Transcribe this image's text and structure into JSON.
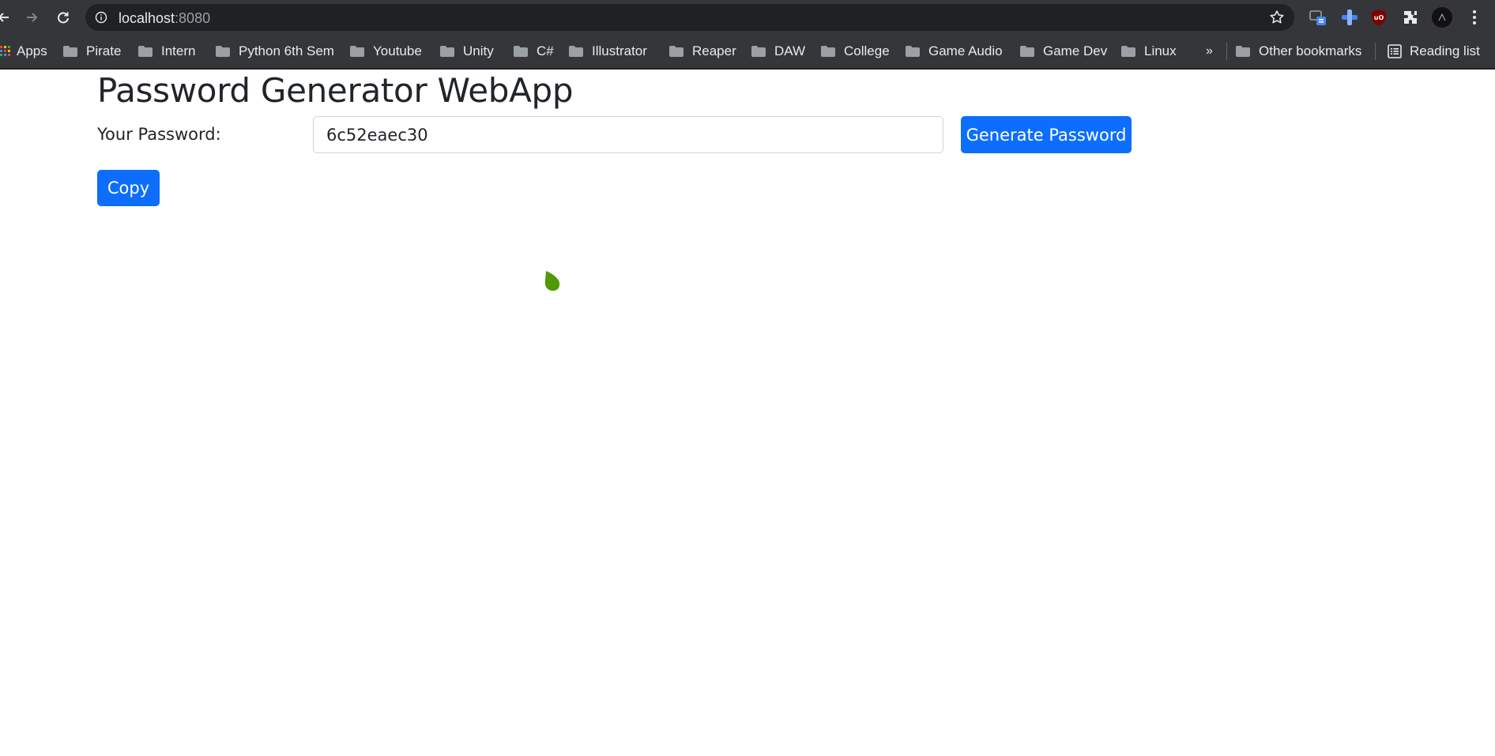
{
  "browser": {
    "url_host": "localhost",
    "url_port": ":8080",
    "icons": [
      "back-icon",
      "forward-icon",
      "reload-icon",
      "info-icon",
      "star-icon",
      "extensions-icon",
      "menu-icon"
    ]
  },
  "bookmarks": {
    "apps_label": "Apps",
    "items": [
      "Pirate",
      "Intern",
      "Python 6th Sem",
      "Youtube",
      "Unity",
      "C#",
      "Illustrator",
      "Reaper",
      "DAW",
      "College",
      "Game Audio",
      "Game Dev",
      "Linux"
    ],
    "overflow_label": "»",
    "other_label": "Other bookmarks",
    "reading_list_label": "Reading list"
  },
  "page": {
    "title": "Password Generator WebApp",
    "password_label": "Your Password:",
    "password_value": "6c52eaec30",
    "generate_button_label": "Generate Password",
    "copy_button_label": "Copy"
  },
  "colors": {
    "primary_button": "#0d6efd",
    "chrome_bg": "#35363a",
    "omnibox_bg": "#202124"
  }
}
